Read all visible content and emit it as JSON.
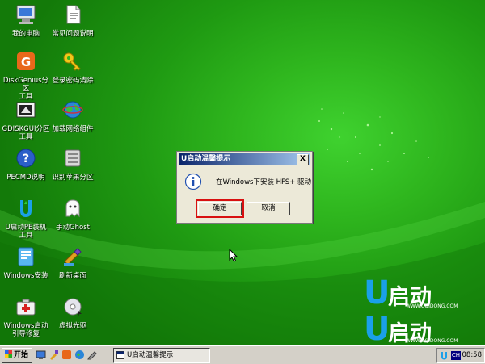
{
  "desktop_icons": [
    {
      "label": "我的电脑",
      "icon": "computer-icon"
    },
    {
      "label": "常见问题说明",
      "icon": "document-icon"
    },
    {
      "label": "DiskGenius分区\n工具",
      "icon": "diskgenius-icon"
    },
    {
      "label": "登录密码清除",
      "icon": "key-icon"
    },
    {
      "label": "GDISKGUI分区\n工具",
      "icon": "gdisk-icon"
    },
    {
      "label": "加载网络组件",
      "icon": "network-globe-icon"
    },
    {
      "label": "PECMD说明",
      "icon": "help-icon"
    },
    {
      "label": "识别苹果分区",
      "icon": "apple-partition-icon"
    },
    {
      "label": "U启动PE装机\n工具",
      "icon": "installer-icon"
    },
    {
      "label": "手动Ghost",
      "icon": "ghost-icon"
    },
    {
      "label": "Windows安装",
      "icon": "windows-setup-icon"
    },
    {
      "label": "刷新桌面",
      "icon": "refresh-desktop-icon"
    },
    {
      "label": "Windows启动\n引导修复",
      "icon": "boot-repair-icon"
    },
    {
      "label": "虚拟光驱",
      "icon": "virtual-cd-icon"
    }
  ],
  "dialog": {
    "title": "U启动温馨提示",
    "close_label": "X",
    "message": "在Windows下安装 HFS+ 驱动",
    "ok_label": "确定",
    "cancel_label": "取消"
  },
  "taskbar": {
    "start_label": "开始",
    "task_item_label": "U启动温馨提示",
    "tray_lang": "CH",
    "clock": "08:58"
  },
  "brand": {
    "logo_char": "U",
    "logo_text": "启动",
    "url": "WWW.UQIDONG.COM"
  },
  "colors": {
    "desktop_green": "#2fb61e",
    "titlebar_start": "#0a246a",
    "titlebar_end": "#a6caf0",
    "ok_highlight": "#d81010",
    "brand_blue": "#1aa0e8"
  }
}
